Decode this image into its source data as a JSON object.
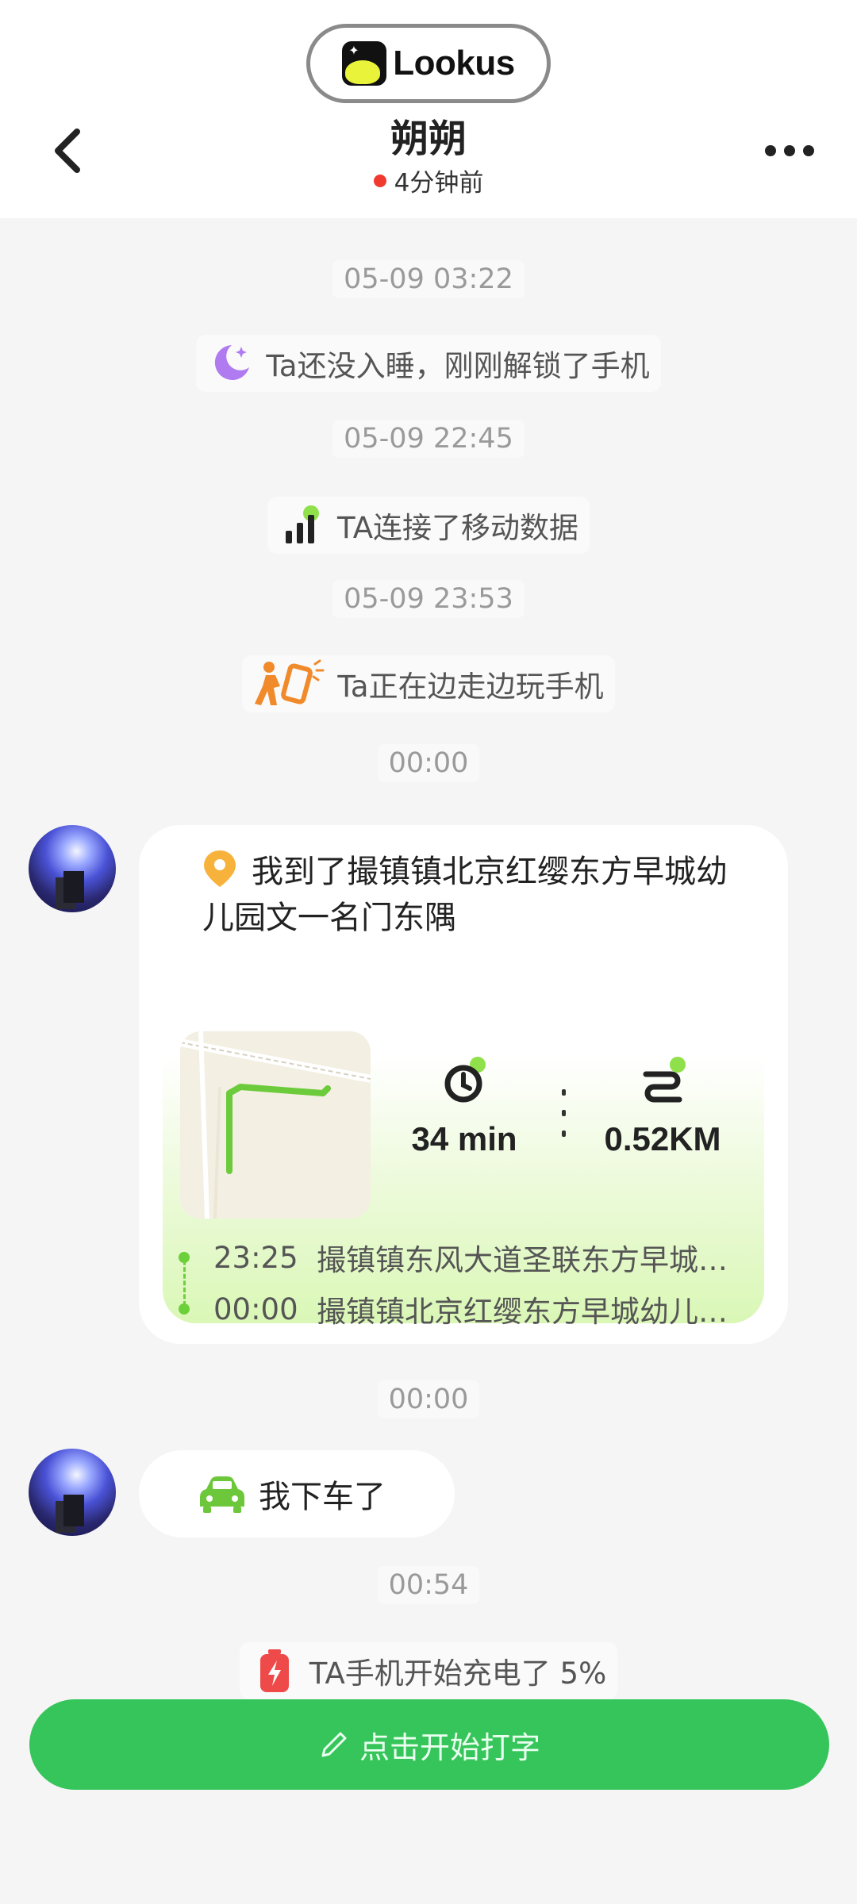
{
  "header": {
    "app_name": "Lookus",
    "contact_name": "朔朔",
    "status": "4分钟前"
  },
  "timeline": [
    {
      "timestamp": "05-09 03:22",
      "notice": "Ta还没入睡，刚刚解锁了手机",
      "icon": "moon-icon"
    },
    {
      "timestamp": "05-09 22:45",
      "notice": "TA连接了移动数据",
      "icon": "signal-icon"
    },
    {
      "timestamp": "05-09 23:53",
      "notice": "Ta正在边走边玩手机",
      "icon": "walking-phone-icon"
    },
    {
      "timestamp": "00:00"
    },
    {
      "timestamp": "00:00"
    },
    {
      "timestamp": "00:54",
      "notice": "TA手机开始充电了 5%",
      "icon": "battery-charging-icon"
    }
  ],
  "location_card": {
    "title": "我到了撮镇镇北京红缨东方早城幼儿园文一名门东隅",
    "duration": "34 min",
    "distance": "0.52KM",
    "route": [
      {
        "time": "23:25",
        "address": "撮镇镇东风大道圣联东方早城幼儿园"
      },
      {
        "time": "00:00",
        "address": "撮镇镇北京红缨东方早城幼儿园文一名门东隅"
      }
    ]
  },
  "car_message": {
    "text": "我下车了",
    "icon": "car-icon"
  },
  "input_bar": {
    "placeholder": "点击开始打字",
    "icon": "pencil-icon"
  },
  "colors": {
    "accent_green": "#36c55a",
    "online_red": "#f03a30",
    "route_green": "#6cd03a"
  }
}
